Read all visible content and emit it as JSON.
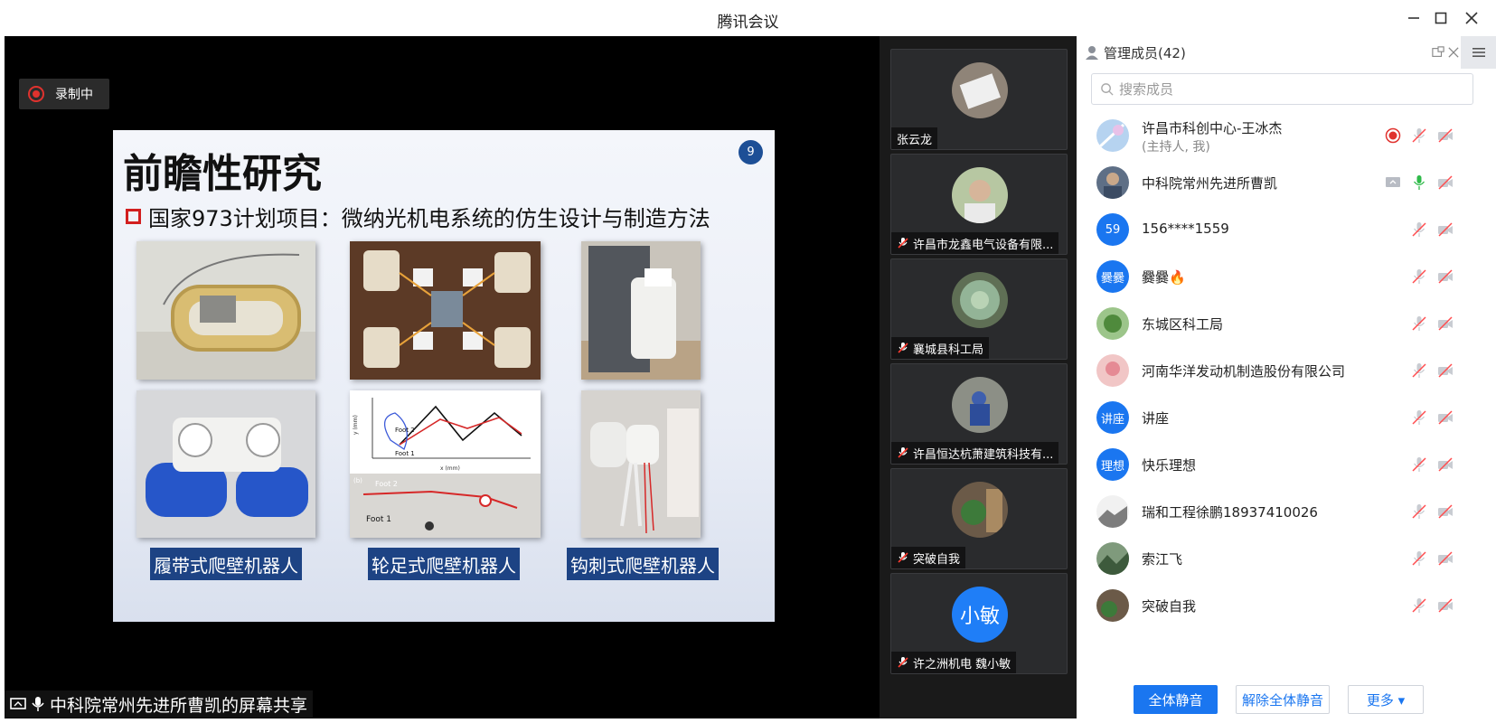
{
  "window": {
    "title": "腾讯会议"
  },
  "recording": {
    "label": "录制中"
  },
  "slide": {
    "title": "前瞻性研究",
    "page_number": "9",
    "subtitle": "国家973计划项目：微纳光机电系统的仿生设计与制造方法",
    "captions": [
      "履带式爬壁机器人",
      "轮足式爬壁机器人",
      "钩刺式爬壁机器人"
    ],
    "chart_labels": {
      "foot2": "Foot 2",
      "foot1": "Foot 1",
      "xaxis": "x (mm)",
      "yaxis": "y (mm)",
      "panel_b": "(b)"
    }
  },
  "share_status": "中科院常州先进所曹凯的屏幕共享",
  "tiles": [
    {
      "name": "张云龙",
      "muted": false
    },
    {
      "name": "许昌市龙鑫电气设备有限...",
      "muted": true
    },
    {
      "name": "襄城县科工局",
      "muted": true
    },
    {
      "name": "许昌恒达杭萧建筑科技有...",
      "muted": true
    },
    {
      "name": "突破自我",
      "muted": true
    },
    {
      "name": "许之洲机电  魏小敏",
      "muted": true,
      "avatar_text": "小敏"
    }
  ],
  "panel": {
    "title": "管理成员(42)",
    "search_placeholder": "搜索成员",
    "members": [
      {
        "name": "许昌市科创中心-王冰杰",
        "role": "(主持人, 我)"
      },
      {
        "name": "中科院常州先进所曹凯"
      },
      {
        "name": "156****1559",
        "avatar_text": "59"
      },
      {
        "name": "爨爨🔥",
        "avatar_text": "爨爨"
      },
      {
        "name": "东城区科工局"
      },
      {
        "name": "河南华洋发动机制造股份有限公司"
      },
      {
        "name": "讲座",
        "avatar_text": "讲座"
      },
      {
        "name": "快乐理想",
        "avatar_text": "理想"
      },
      {
        "name": "瑞和工程徐鹏18937410026"
      },
      {
        "name": "索江飞"
      },
      {
        "name": "突破自我"
      }
    ],
    "buttons": {
      "mute_all": "全体静音",
      "unmute_all": "解除全体静音",
      "more": "更多 ▾"
    }
  }
}
